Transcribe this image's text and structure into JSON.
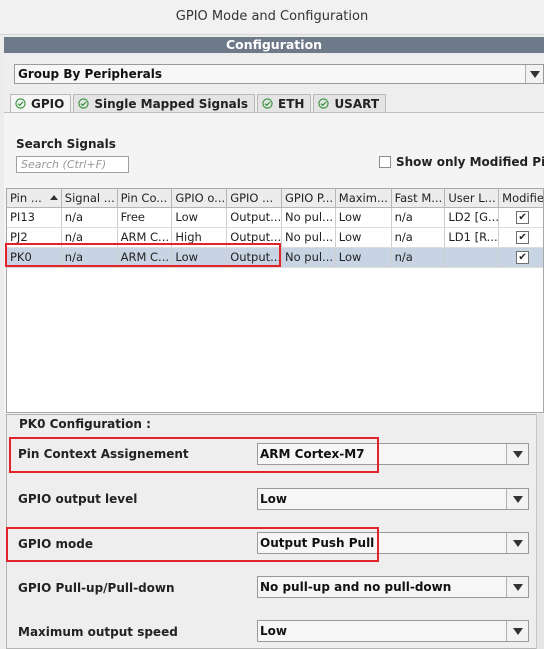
{
  "window_title": "GPIO Mode and Configuration",
  "section_header": "Configuration",
  "group_select": {
    "value": "Group By Peripherals"
  },
  "tabs": [
    {
      "label": "GPIO",
      "active": true
    },
    {
      "label": "Single Mapped Signals",
      "active": false
    },
    {
      "label": "ETH",
      "active": false
    },
    {
      "label": "USART",
      "active": false
    }
  ],
  "search": {
    "label": "Search Signals",
    "placeholder": "Search (Ctrl+F)"
  },
  "show_modified": {
    "label": "Show only Modified Pins",
    "checked": false
  },
  "table": {
    "columns": [
      "Pin ...",
      "Signal ...",
      "Pin Co...",
      "GPIO o...",
      "GPIO ...",
      "GPIO P...",
      "Maxim...",
      "Fast M...",
      "User L...",
      "Modifie"
    ],
    "rows": [
      {
        "cells": [
          "PI13",
          "n/a",
          "Free",
          "Low",
          "Output...",
          "No pul...",
          "Low",
          "n/a",
          "LD2 [G..."
        ],
        "modified": true,
        "selected": false
      },
      {
        "cells": [
          "PJ2",
          "n/a",
          "ARM C...",
          "High",
          "Output...",
          "No pul...",
          "Low",
          "n/a",
          "LD1 [R..."
        ],
        "modified": true,
        "selected": false
      },
      {
        "cells": [
          "PK0",
          "n/a",
          "ARM C...",
          "Low",
          "Output...",
          "No pul...",
          "Low",
          "n/a",
          ""
        ],
        "modified": true,
        "selected": true
      }
    ]
  },
  "pin_config": {
    "title": "PK0 Configuration :",
    "fields": [
      {
        "label": "Pin Context Assignement",
        "value": "ARM Cortex-M7"
      },
      {
        "label": "GPIO output level",
        "value": "Low"
      },
      {
        "label": "GPIO mode",
        "value": "Output Push Pull"
      },
      {
        "label": "GPIO Pull-up/Pull-down",
        "value": "No pull-up and no pull-down"
      },
      {
        "label": "Maximum output speed",
        "value": "Low"
      }
    ]
  },
  "colors": {
    "highlight": "#e2232a",
    "header_bar": "#6e7a8a",
    "selected_row": "#c8d4e4"
  }
}
